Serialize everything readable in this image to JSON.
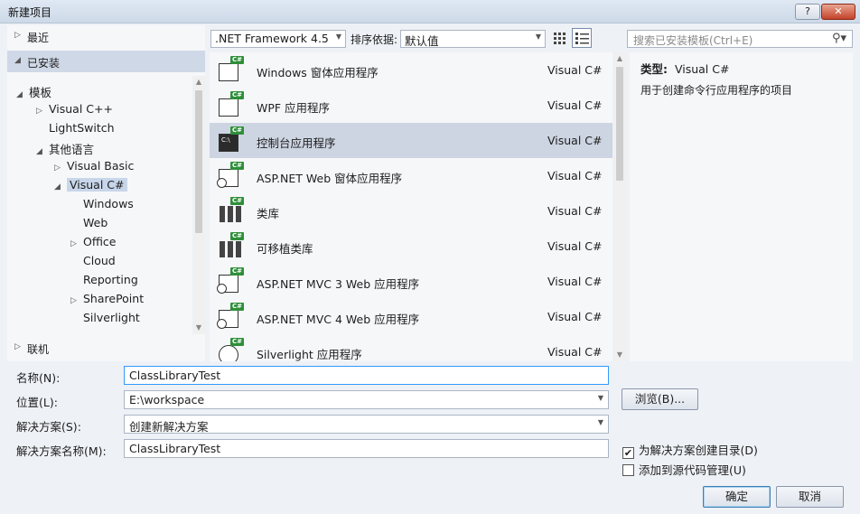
{
  "window": {
    "title": "新建项目",
    "help_label": "?",
    "close_label": "✕"
  },
  "left": {
    "recent": "最近",
    "installed": "已安装",
    "online": "联机",
    "tree": [
      {
        "label": "模板",
        "arrow": "◢"
      },
      {
        "label": "Visual C++",
        "arrow": "▷"
      },
      {
        "label": "LightSwitch",
        "arrow": ""
      },
      {
        "label": "其他语言",
        "arrow": "◢"
      },
      {
        "label": "Visual Basic",
        "arrow": "▷"
      },
      {
        "label": "Visual C#",
        "arrow": "◢"
      },
      {
        "label": "Windows",
        "arrow": ""
      },
      {
        "label": "Web",
        "arrow": ""
      },
      {
        "label": "Office",
        "arrow": "▷"
      },
      {
        "label": "Cloud",
        "arrow": ""
      },
      {
        "label": "Reporting",
        "arrow": ""
      },
      {
        "label": "SharePoint",
        "arrow": "▷"
      },
      {
        "label": "Silverlight",
        "arrow": ""
      }
    ]
  },
  "toolbar": {
    "framework": ".NET Framework 4.5",
    "sort_label": "排序依据:",
    "sort_value": "默认值",
    "search_placeholder": "搜索已安装模板(Ctrl+E)"
  },
  "templates": [
    {
      "name": "Windows 窗体应用程序",
      "lang": "Visual C#",
      "icon": "window"
    },
    {
      "name": "WPF 应用程序",
      "lang": "Visual C#",
      "icon": "wpf"
    },
    {
      "name": "控制台应用程序",
      "lang": "Visual C#",
      "icon": "console"
    },
    {
      "name": "ASP.NET Web 窗体应用程序",
      "lang": "Visual C#",
      "icon": "web"
    },
    {
      "name": "类库",
      "lang": "Visual C#",
      "icon": "library"
    },
    {
      "name": "可移植类库",
      "lang": "Visual C#",
      "icon": "library"
    },
    {
      "name": "ASP.NET MVC 3 Web 应用程序",
      "lang": "Visual C#",
      "icon": "web"
    },
    {
      "name": "ASP.NET MVC 4 Web 应用程序",
      "lang": "Visual C#",
      "icon": "web"
    },
    {
      "name": "Silverlight 应用程序",
      "lang": "Visual C#",
      "icon": "silverlight"
    }
  ],
  "description": {
    "type_label": "类型:",
    "type_value": "Visual C#",
    "text": "用于创建命令行应用程序的项目"
  },
  "form": {
    "name_label": "名称(N):",
    "name_value": "ClassLibraryTest",
    "location_label": "位置(L):",
    "location_value": "E:\\workspace",
    "solution_label": "解决方案(S):",
    "solution_value": "创建新解决方案",
    "solution_name_label": "解决方案名称(M):",
    "solution_name_value": "ClassLibraryTest",
    "browse_label": "浏览(B)...",
    "create_dir_label": "为解决方案创建目录(D)",
    "create_dir_checked": true,
    "source_control_label": "添加到源代码管理(U)",
    "source_control_checked": false,
    "ok_label": "确定",
    "cancel_label": "取消"
  }
}
